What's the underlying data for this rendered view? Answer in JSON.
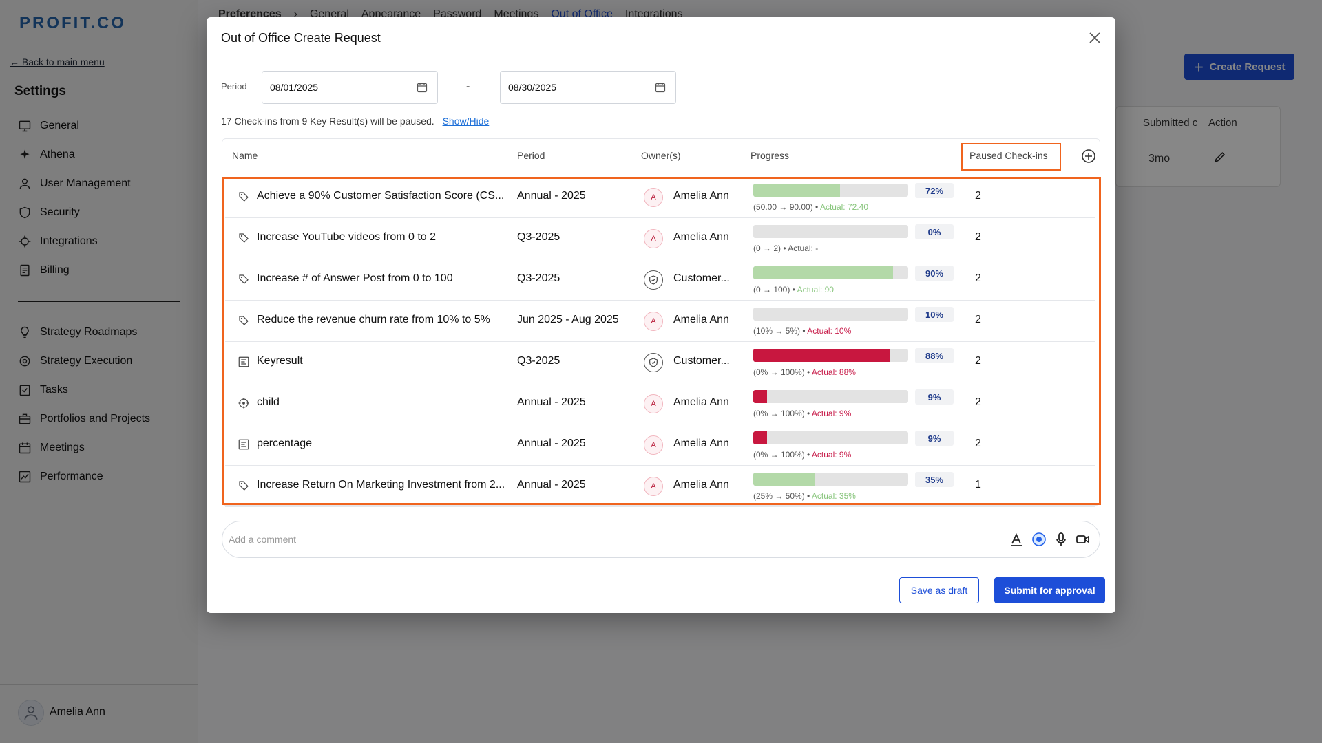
{
  "app": {
    "logo": "PROFIT.CO"
  },
  "sidebar": {
    "back_label": "← Back to main menu",
    "title": "Settings",
    "items": [
      {
        "label": "General",
        "icon": "monitor-icon"
      },
      {
        "label": "Athena",
        "icon": "sparkle-icon"
      },
      {
        "label": "User Management",
        "icon": "user-icon"
      },
      {
        "label": "Security",
        "icon": "shield-icon"
      },
      {
        "label": "Integrations",
        "icon": "puzzle-icon"
      },
      {
        "label": "Billing",
        "icon": "receipt-icon"
      }
    ],
    "items2": [
      {
        "label": "Strategy Roadmaps",
        "icon": "lightbulb-icon"
      },
      {
        "label": "Strategy Execution",
        "icon": "target-icon"
      },
      {
        "label": "Tasks",
        "icon": "checklist-icon"
      },
      {
        "label": "Portfolios and Projects",
        "icon": "briefcase-icon"
      },
      {
        "label": "Meetings",
        "icon": "calendar-icon"
      },
      {
        "label": "Performance",
        "icon": "chart-icon"
      }
    ],
    "user": "Amelia Ann"
  },
  "topnav": {
    "breadcrumb": "Preferences",
    "tabs": [
      "General",
      "Appearance",
      "Password",
      "Meetings",
      "Out of Office",
      "Integrations"
    ],
    "active": "Out of Office"
  },
  "background": {
    "create_label": "Create Request",
    "col_submitted": "Submitted c",
    "col_action": "Action",
    "row_time": "3mo"
  },
  "modal": {
    "title": "Out of Office Create Request",
    "period_label": "Period",
    "start_date": "08/01/2025",
    "end_date": "08/30/2025",
    "date_separator": "-",
    "info_text": "17 Check-ins from 9 Key Result(s) will be paused.",
    "show_hide": "Show/Hide",
    "columns": {
      "name": "Name",
      "period": "Period",
      "owners": "Owner(s)",
      "progress": "Progress",
      "paused": "Paused Check-ins"
    },
    "rows": [
      {
        "icon": "key-result-icon",
        "name": "Achieve a 90% Customer Satisfaction Score (CS...",
        "period": "Annual - 2025",
        "owner": "Amelia Ann",
        "owner_initial": "A",
        "owner_type": "user",
        "progress": 0.56,
        "bar_color": "#b3d9a8",
        "pct": "72%",
        "range": "(50.00 → 90.00) •",
        "actual": "Actual: 72.40",
        "actual_color": "green",
        "paused": "2"
      },
      {
        "icon": "key-result-icon",
        "name": "Increase YouTube videos from 0 to 2",
        "period": "Q3-2025",
        "owner": "Amelia Ann",
        "owner_initial": "A",
        "owner_type": "user",
        "progress": 0,
        "bar_color": "#b3d9a8",
        "pct": "0%",
        "range": "(0 → 2) •",
        "actual": "Actual: -",
        "actual_color": "plain",
        "paused": "2"
      },
      {
        "icon": "key-result-icon",
        "name": "Increase # of Answer Post from 0 to 100",
        "period": "Q3-2025",
        "owner": "Customer...",
        "owner_initial": "",
        "owner_type": "team",
        "progress": 0.9,
        "bar_color": "#b3d9a8",
        "pct": "90%",
        "range": "(0 → 100) •",
        "actual": "Actual: 90",
        "actual_color": "green",
        "paused": "2"
      },
      {
        "icon": "key-result-icon",
        "name": "Reduce the revenue churn rate from 10% to 5%",
        "period": "Jun 2025 - Aug 2025",
        "owner": "Amelia Ann",
        "owner_initial": "A",
        "owner_type": "user",
        "progress": 0,
        "bar_color": "#b3d9a8",
        "pct": "10%",
        "range": "(10% → 5%) •",
        "actual": "Actual: 10%",
        "actual_color": "red",
        "paused": "2"
      },
      {
        "icon": "list-icon",
        "name": "Keyresult",
        "period": "Q3-2025",
        "owner": "Customer...",
        "owner_initial": "",
        "owner_type": "team",
        "progress": 0.88,
        "bar_color": "#c8173f",
        "pct": "88%",
        "range": "(0% → 100%) •",
        "actual": "Actual: 88%",
        "actual_color": "red",
        "paused": "2"
      },
      {
        "icon": "crosshair-icon",
        "name": "child",
        "period": "Annual - 2025",
        "owner": "Amelia Ann",
        "owner_initial": "A",
        "owner_type": "user",
        "progress": 0.09,
        "bar_color": "#c8173f",
        "pct": "9%",
        "range": "(0% → 100%) •",
        "actual": "Actual: 9%",
        "actual_color": "red",
        "paused": "2"
      },
      {
        "icon": "list-icon",
        "name": "percentage",
        "period": "Annual - 2025",
        "owner": "Amelia Ann",
        "owner_initial": "A",
        "owner_type": "user",
        "progress": 0.09,
        "bar_color": "#c8173f",
        "pct": "9%",
        "range": "(0% → 100%) •",
        "actual": "Actual: 9%",
        "actual_color": "red",
        "paused": "2"
      },
      {
        "icon": "key-result-icon",
        "name": "Increase Return On Marketing Investment from 2...",
        "period": "Annual - 2025",
        "owner": "Amelia Ann",
        "owner_initial": "A",
        "owner_type": "user",
        "progress": 0.4,
        "bar_color": "#b3d9a8",
        "pct": "35%",
        "range": "(25% → 50%) •",
        "actual": "Actual: 35%",
        "actual_color": "green",
        "paused": "1"
      }
    ],
    "comment_placeholder": "Add a comment",
    "comment_icons": [
      "text-format-icon",
      "ai-assist-icon",
      "microphone-icon",
      "video-icon"
    ],
    "save_draft": "Save as draft",
    "submit": "Submit for approval"
  },
  "colors": {
    "accent": "#1d4ed8",
    "highlight": "#f0641e",
    "success": "#b3d9a8",
    "danger": "#c8173f"
  }
}
